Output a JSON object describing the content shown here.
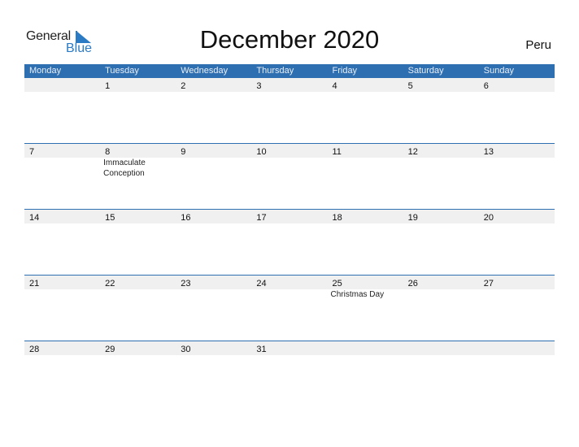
{
  "logo": {
    "line1": "General",
    "line2": "Blue"
  },
  "title": "December 2020",
  "country": "Peru",
  "colors": {
    "header": "#2e6fb2",
    "row_band": "#f0f0f0",
    "brand": "#2a7ac4"
  },
  "weekdays": [
    "Monday",
    "Tuesday",
    "Wednesday",
    "Thursday",
    "Friday",
    "Saturday",
    "Sunday"
  ],
  "weeks": [
    {
      "days": [
        "",
        "1",
        "2",
        "3",
        "4",
        "5",
        "6"
      ],
      "events": [
        "",
        "",
        "",
        "",
        "",
        "",
        ""
      ]
    },
    {
      "days": [
        "7",
        "8",
        "9",
        "10",
        "11",
        "12",
        "13"
      ],
      "events": [
        "",
        "Immaculate Conception",
        "",
        "",
        "",
        "",
        ""
      ]
    },
    {
      "days": [
        "14",
        "15",
        "16",
        "17",
        "18",
        "19",
        "20"
      ],
      "events": [
        "",
        "",
        "",
        "",
        "",
        "",
        ""
      ]
    },
    {
      "days": [
        "21",
        "22",
        "23",
        "24",
        "25",
        "26",
        "27"
      ],
      "events": [
        "",
        "",
        "",
        "",
        "Christmas Day",
        "",
        ""
      ]
    },
    {
      "days": [
        "28",
        "29",
        "30",
        "31",
        "",
        "",
        ""
      ],
      "events": [
        "",
        "",
        "",
        "",
        "",
        "",
        ""
      ]
    }
  ]
}
